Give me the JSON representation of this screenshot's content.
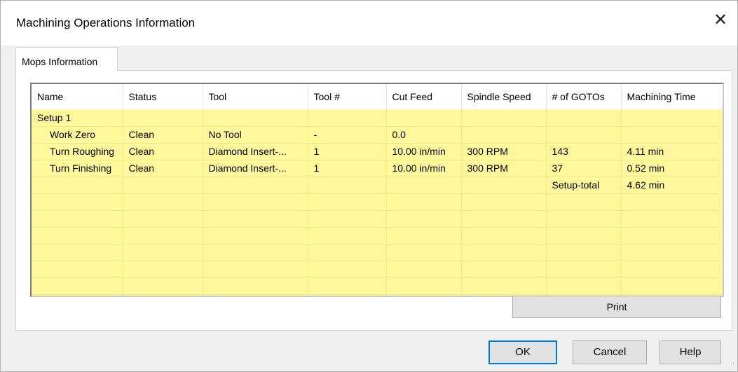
{
  "window": {
    "title": "Machining Operations Information",
    "close_glyph": "✕"
  },
  "tabs": [
    {
      "label": "Mops Information"
    }
  ],
  "table": {
    "columns": [
      "Name",
      "Status",
      "Tool",
      "Tool #",
      "Cut Feed",
      "Spindle Speed",
      "# of GOTOs",
      "Machining Time"
    ],
    "rows": [
      [
        "Setup 1",
        "",
        "",
        "",
        "",
        "",
        "",
        ""
      ],
      [
        "Work Zero",
        "Clean",
        "No Tool",
        "-",
        "0.0",
        "",
        "",
        ""
      ],
      [
        "Turn Roughing",
        "Clean",
        "Diamond Insert-...",
        "1",
        "10.00 in/min",
        "300 RPM",
        "143",
        "4.11 min"
      ],
      [
        "Turn Finishing",
        "Clean",
        "Diamond Insert-...",
        "1",
        "10.00 in/min",
        "300 RPM",
        "37",
        "0.52 min"
      ],
      [
        "",
        "",
        "",
        "",
        "",
        "",
        "Setup-total",
        "4.62 min"
      ],
      [
        "",
        "",
        "",
        "",
        "",
        "",
        "",
        ""
      ],
      [
        "",
        "",
        "",
        "",
        "",
        "",
        "",
        ""
      ],
      [
        "",
        "",
        "",
        "",
        "",
        "",
        "",
        ""
      ],
      [
        "",
        "",
        "",
        "",
        "",
        "",
        "",
        ""
      ],
      [
        "",
        "",
        "",
        "",
        "",
        "",
        "",
        ""
      ],
      [
        "",
        "",
        "",
        "",
        "",
        "",
        "",
        ""
      ]
    ],
    "indented_rows": [
      1,
      2,
      3
    ],
    "row_background": "#fff79c"
  },
  "buttons": {
    "print": "Print",
    "ok": "OK",
    "cancel": "Cancel",
    "help": "Help"
  },
  "colors": {
    "focus_border": "#0078d7",
    "dialog_bg": "#f0f0f0"
  }
}
